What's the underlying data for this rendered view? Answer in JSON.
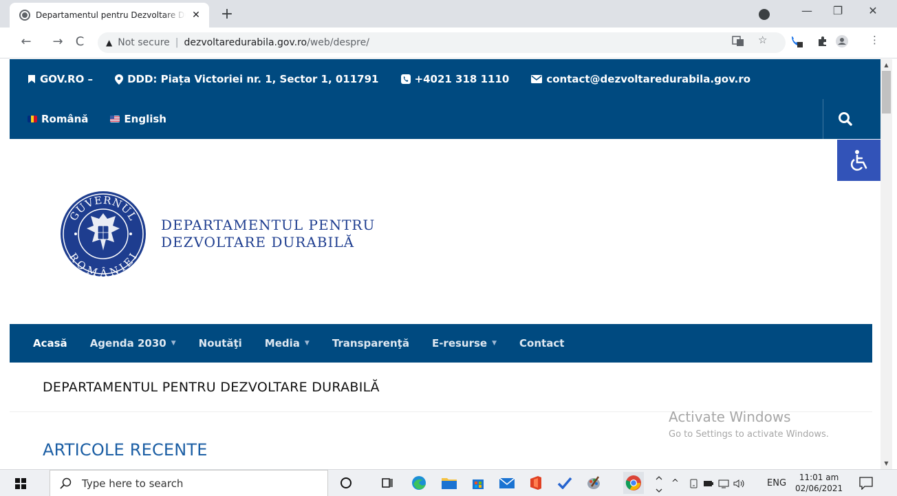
{
  "browser": {
    "tab_title": "Departamentul pentru Dezvoltare Durabilă",
    "tab_close": "✕",
    "new_tab": "+",
    "security_label": "Not secure",
    "url_host": "dezvoltaredurabila.gov.ro",
    "url_path": "/web/despre/",
    "back_icon": "←",
    "forward_icon": "→",
    "reload_icon": "C",
    "star_icon": "☆",
    "menu_icon": "⋮",
    "minimize": "—",
    "maximize": "❐",
    "close": "✕"
  },
  "topbar": {
    "gov_label": "GOV.RO –",
    "address": "DDD: Piața Victoriei nr. 1, Sector 1, 011791",
    "phone": "+4021 318 1110",
    "email": "contact@dezvoltaredurabila.gov.ro",
    "lang_ro": "Română",
    "lang_en": "English"
  },
  "logo": {
    "seal_top": "GUVERNUL",
    "seal_bottom": "ROMÂNIEI",
    "line1": "DEPARTAMENTUL PENTRU",
    "line2": "DEZVOLTARE DURABILĂ"
  },
  "nav": {
    "home": "Acasă",
    "agenda": "Agenda 2030",
    "news": "Noutăţi",
    "media": "Media",
    "transparency": "Transparenţă",
    "eresources": "E-resurse",
    "contact": "Contact",
    "caret": "▼"
  },
  "page": {
    "title": "DEPARTAMENTUL PENTRU DEZVOLTARE DURABILĂ",
    "recent_heading": "ARTICOLE RECENTE"
  },
  "watermark": {
    "title": "Activate Windows",
    "subtitle": "Go to Settings to activate Windows."
  },
  "taskbar": {
    "search_placeholder": "Type here to search",
    "language": "ENG",
    "time": "11:01 am",
    "date": "02/06/2021"
  },
  "colors": {
    "brand_blue": "#004a80",
    "accessibility_blue": "#3253b8",
    "heading_blue": "#1b5ea4"
  }
}
